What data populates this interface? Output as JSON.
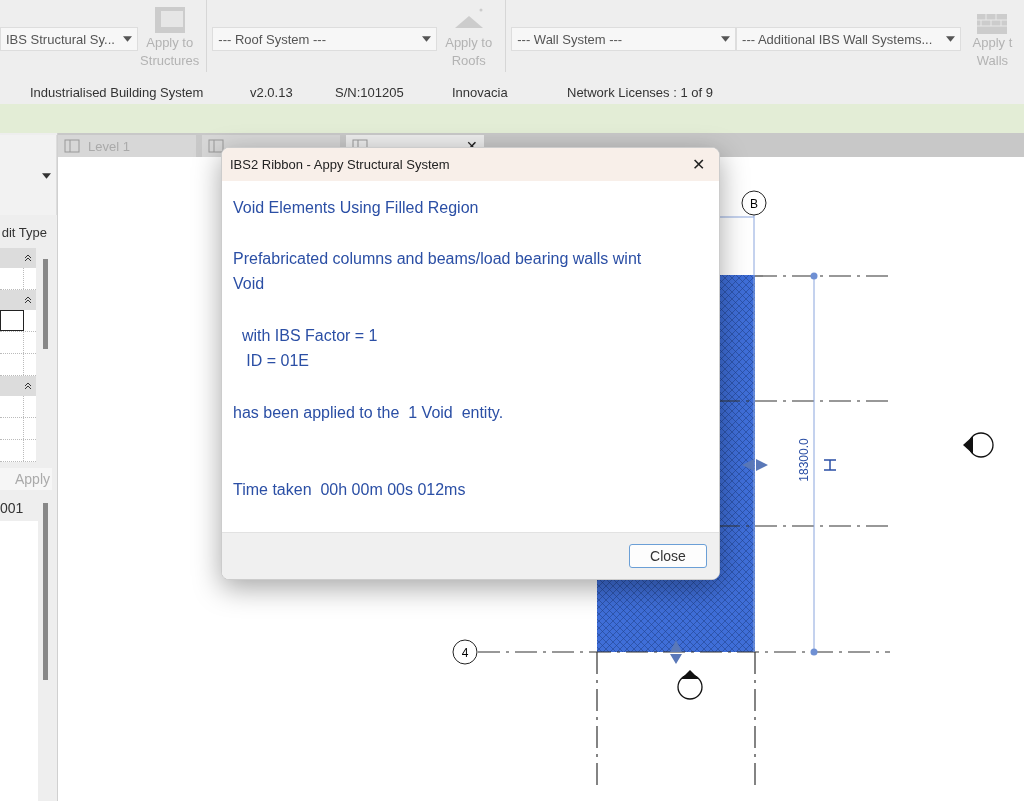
{
  "ribbon": {
    "groups": [
      {
        "kind": "dropdown",
        "value": "IBS Structural Sy..."
      },
      {
        "kind": "button",
        "lines": [
          "Apply to",
          "Structures"
        ],
        "disabled": true
      },
      {
        "kind": "separator"
      },
      {
        "kind": "dropdown",
        "value": "--- Roof System ---"
      },
      {
        "kind": "button",
        "lines": [
          "Apply to",
          "Roofs"
        ],
        "disabled": true
      },
      {
        "kind": "separator"
      },
      {
        "kind": "dropdown",
        "value": "--- Wall System ---"
      },
      {
        "kind": "dropdown",
        "value": "--- Additional IBS Wall Systems..."
      },
      {
        "kind": "button",
        "lines": [
          "Apply t",
          "Walls"
        ],
        "disabled": true
      }
    ]
  },
  "info_bar": [
    "Industrialised Building System",
    "v2.0.13",
    "S/N:101205",
    "Innovacia",
    "Network Licenses : 1 of 9"
  ],
  "tabs": [
    {
      "label": "Level 1",
      "selected": false
    },
    {
      "selected": false
    },
    {
      "selected": true,
      "close": "✕"
    }
  ],
  "properties": {
    "edit_type": "dit Type",
    "apply": "Apply",
    "apply_disabled": true,
    "browser_item": "001"
  },
  "drawing": {
    "grid_bubbles": [
      "B",
      "4"
    ],
    "dimension": "18300.0"
  },
  "dialog": {
    "title": "IBS2 Ribbon - Appy Structural System",
    "close": "✕",
    "message": [
      {
        "kind": "heading",
        "lines": [
          "Void Elements Using Filled Region"
        ]
      },
      {
        "kind": "paragraph",
        "lines": [
          "Prefabricated columns and beams/load bearing walls wint",
          "Void"
        ]
      },
      {
        "kind": "detail",
        "lines": [
          "  with IBS Factor = 1"
        ]
      },
      {
        "kind": "detail",
        "lines": [
          "   ID = 01E"
        ]
      },
      {
        "kind": "result",
        "lines": [
          "has been applied to the  1 Void  entity."
        ]
      },
      {
        "kind": "timing",
        "lines": [
          "Time taken  00h 00m 00s 012ms"
        ]
      }
    ],
    "button": "Close"
  }
}
